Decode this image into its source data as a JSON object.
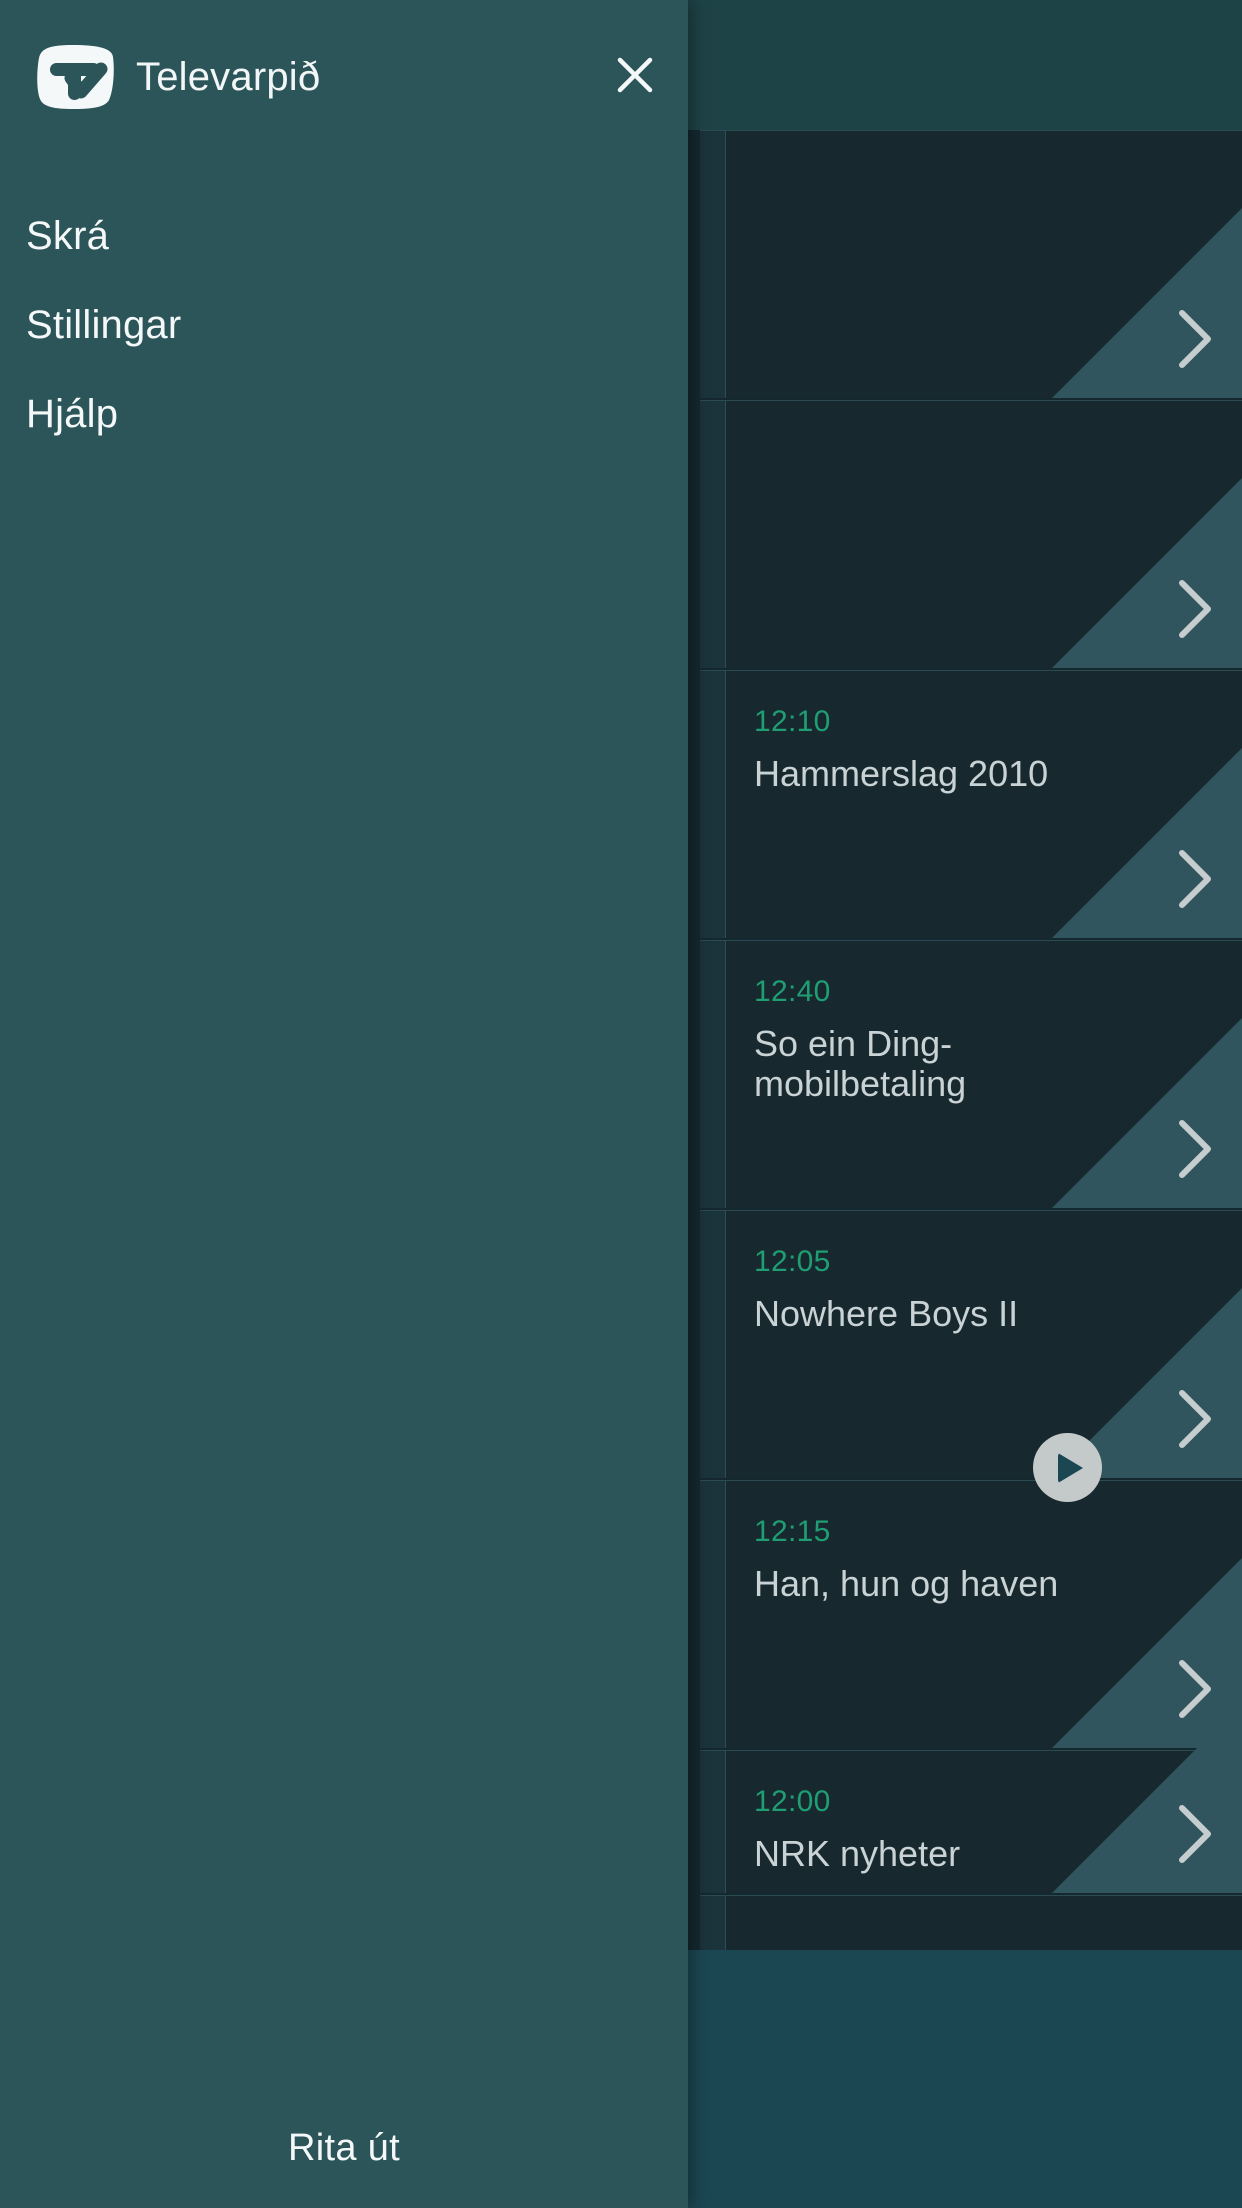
{
  "colors": {
    "drawer_bg": "#2c5559",
    "screen_bg": "#24484c",
    "card_bg": "#17292f",
    "time_accent": "#1f9e74",
    "title_text": "#c9d2d4",
    "play_button": "#c4c9ca",
    "player_bg": "#1b4752"
  },
  "drawer": {
    "brand_name": "Televarpið",
    "logo_icon": "tv-logo-icon",
    "close_icon": "close-icon",
    "menu": [
      {
        "label": "Skrá"
      },
      {
        "label": "Stillingar"
      },
      {
        "label": "Hjálp"
      }
    ],
    "sign_out_label": "Rita út"
  },
  "background": {
    "chevron_icon": "chevron-right-icon",
    "play_icon": "play-icon",
    "programs": [
      {
        "time": "",
        "title": ""
      },
      {
        "time": "",
        "title": ""
      },
      {
        "time": "12:10",
        "title": "Hammerslag 2010"
      },
      {
        "time": "12:40",
        "title": "So ein Ding-mobilbetaling"
      },
      {
        "time": "12:05",
        "title": "Nowhere Boys II"
      },
      {
        "time": "12:15",
        "title": "Han, hun og haven"
      },
      {
        "time": "12:00",
        "title": "NRK nyheter"
      },
      {
        "time": "",
        "title": ""
      }
    ]
  }
}
